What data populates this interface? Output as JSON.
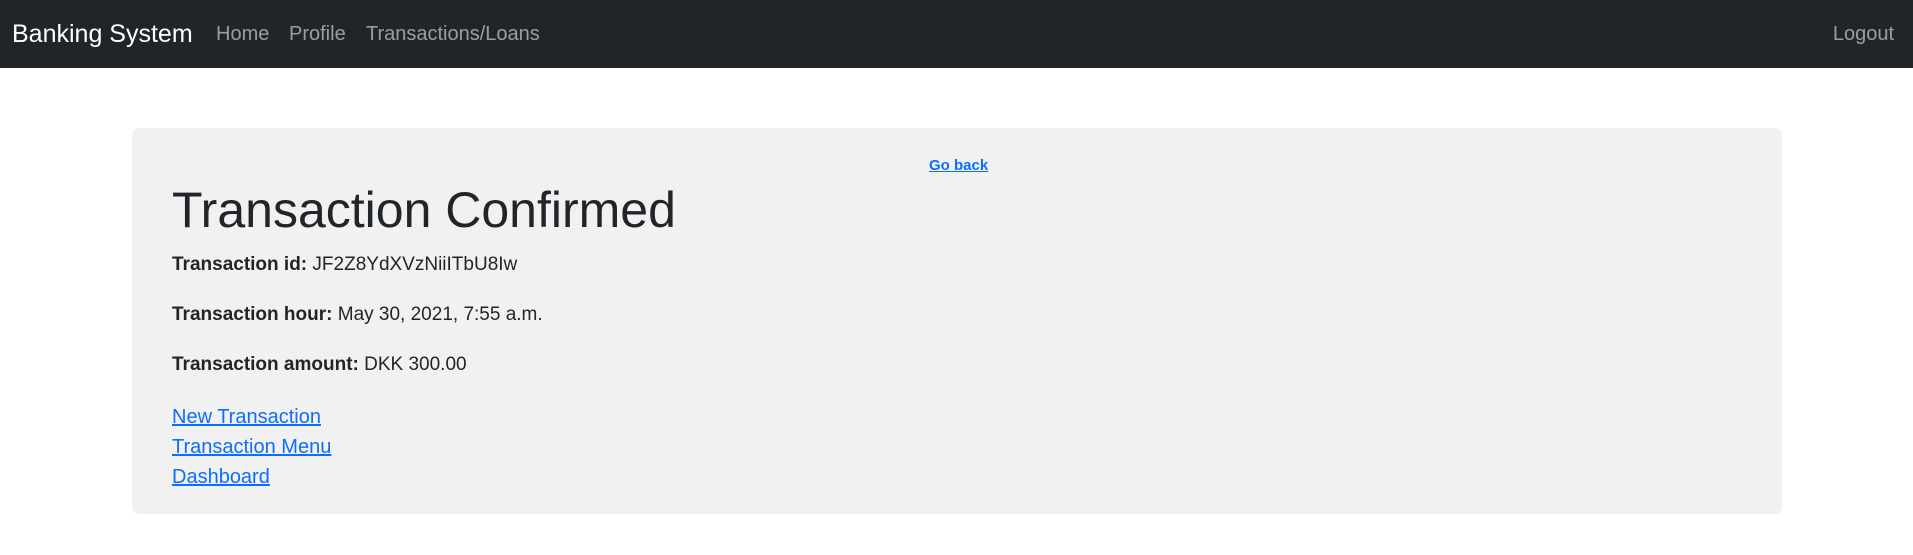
{
  "navbar": {
    "brand": "Banking System",
    "links": [
      "Home",
      "Profile",
      "Transactions/Loans"
    ],
    "logout": "Logout"
  },
  "content": {
    "go_back": "Go back",
    "title": "Transaction Confirmed",
    "fields": {
      "id_label": "Transaction id:",
      "id_value": "JF2Z8YdXVzNiiITbU8Iw",
      "hour_label": "Transaction hour:",
      "hour_value": "May 30, 2021, 7:55 a.m.",
      "amount_label": "Transaction amount:",
      "amount_value": "DKK 300.00"
    },
    "links": [
      "New Transaction",
      "Transaction Menu",
      "Dashboard"
    ]
  },
  "colors": {
    "navbar_bg": "#212529",
    "card_bg": "#f1f1f1",
    "link": "#0d6efd"
  }
}
